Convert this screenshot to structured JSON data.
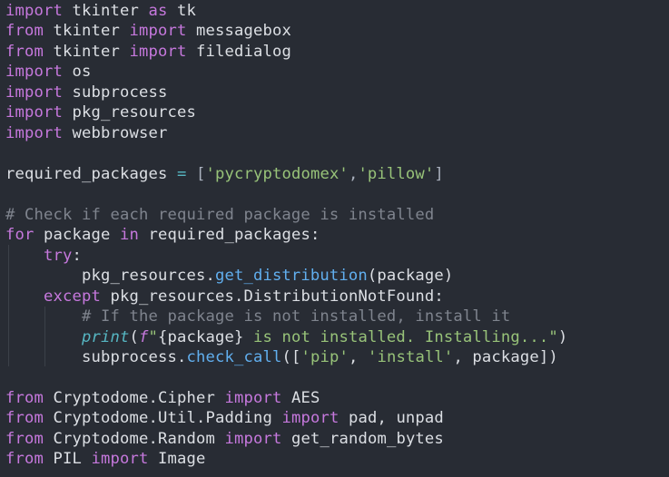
{
  "editor": {
    "lines": [
      [
        {
          "t": "import",
          "c": "kw"
        },
        {
          "t": " tkinter ",
          "c": "id"
        },
        {
          "t": "as",
          "c": "kw"
        },
        {
          "t": " tk",
          "c": "id"
        }
      ],
      [
        {
          "t": "from",
          "c": "kw"
        },
        {
          "t": " tkinter ",
          "c": "id"
        },
        {
          "t": "import",
          "c": "kw"
        },
        {
          "t": " messagebox",
          "c": "id"
        }
      ],
      [
        {
          "t": "from",
          "c": "kw"
        },
        {
          "t": " tkinter ",
          "c": "id"
        },
        {
          "t": "import",
          "c": "kw"
        },
        {
          "t": " filedialog",
          "c": "id"
        }
      ],
      [
        {
          "t": "import",
          "c": "kw"
        },
        {
          "t": " os",
          "c": "id"
        }
      ],
      [
        {
          "t": "import",
          "c": "kw"
        },
        {
          "t": " subprocess",
          "c": "id"
        }
      ],
      [
        {
          "t": "import",
          "c": "kw"
        },
        {
          "t": " pkg_resources",
          "c": "id"
        }
      ],
      [
        {
          "t": "import",
          "c": "kw"
        },
        {
          "t": " webbrowser",
          "c": "id"
        }
      ],
      [],
      [
        {
          "t": "required_packages",
          "c": "id"
        },
        {
          "t": " = ",
          "c": "op"
        },
        {
          "t": "[",
          "c": "pun"
        },
        {
          "t": "'pycryptodomex'",
          "c": "str"
        },
        {
          "t": ",",
          "c": "pun"
        },
        {
          "t": "'pillow'",
          "c": "str"
        },
        {
          "t": "]",
          "c": "pun"
        }
      ],
      [],
      [
        {
          "t": "# Check if each required package is installed",
          "c": "cm"
        }
      ],
      [
        {
          "t": "for",
          "c": "kw"
        },
        {
          "t": " package ",
          "c": "id"
        },
        {
          "t": "in",
          "c": "kw"
        },
        {
          "t": " required_packages:",
          "c": "id"
        }
      ],
      [
        {
          "t": "    ",
          "c": "id"
        },
        {
          "t": "try",
          "c": "kw"
        },
        {
          "t": ":",
          "c": "id"
        }
      ],
      [
        {
          "t": "        pkg_resources.",
          "c": "id"
        },
        {
          "t": "get_distribution",
          "c": "fn"
        },
        {
          "t": "(package)",
          "c": "id"
        }
      ],
      [
        {
          "t": "    ",
          "c": "id"
        },
        {
          "t": "except",
          "c": "kw"
        },
        {
          "t": " pkg_resources.DistributionNotFound:",
          "c": "id"
        }
      ],
      [
        {
          "t": "        ",
          "c": "id"
        },
        {
          "t": "# If the package is not installed, install it",
          "c": "cm"
        }
      ],
      [
        {
          "t": "        ",
          "c": "id"
        },
        {
          "t": "print",
          "c": "bi"
        },
        {
          "t": "(",
          "c": "id"
        },
        {
          "t": "f",
          "c": "pre"
        },
        {
          "t": "\"",
          "c": "str"
        },
        {
          "t": "{package}",
          "c": "id"
        },
        {
          "t": " is not installed. Installing...\"",
          "c": "str"
        },
        {
          "t": ")",
          "c": "id"
        }
      ],
      [
        {
          "t": "        subprocess.",
          "c": "id"
        },
        {
          "t": "check_call",
          "c": "fn"
        },
        {
          "t": "([",
          "c": "id"
        },
        {
          "t": "'pip'",
          "c": "str"
        },
        {
          "t": ", ",
          "c": "id"
        },
        {
          "t": "'install'",
          "c": "str"
        },
        {
          "t": ", package])",
          "c": "id"
        }
      ],
      [],
      [
        {
          "t": "from",
          "c": "kw"
        },
        {
          "t": " Cryptodome.Cipher ",
          "c": "id"
        },
        {
          "t": "import",
          "c": "kw"
        },
        {
          "t": " AES",
          "c": "id"
        }
      ],
      [
        {
          "t": "from",
          "c": "kw"
        },
        {
          "t": " Cryptodome.Util.Padding ",
          "c": "id"
        },
        {
          "t": "import",
          "c": "kw"
        },
        {
          "t": " pad, unpad",
          "c": "id"
        }
      ],
      [
        {
          "t": "from",
          "c": "kw"
        },
        {
          "t": " Cryptodome.Random ",
          "c": "id"
        },
        {
          "t": "import",
          "c": "kw"
        },
        {
          "t": " get_random_bytes",
          "c": "id"
        }
      ],
      [
        {
          "t": "from",
          "c": "kw"
        },
        {
          "t": " PIL ",
          "c": "id"
        },
        {
          "t": "import",
          "c": "kw"
        },
        {
          "t": " Image",
          "c": "id"
        }
      ]
    ]
  }
}
